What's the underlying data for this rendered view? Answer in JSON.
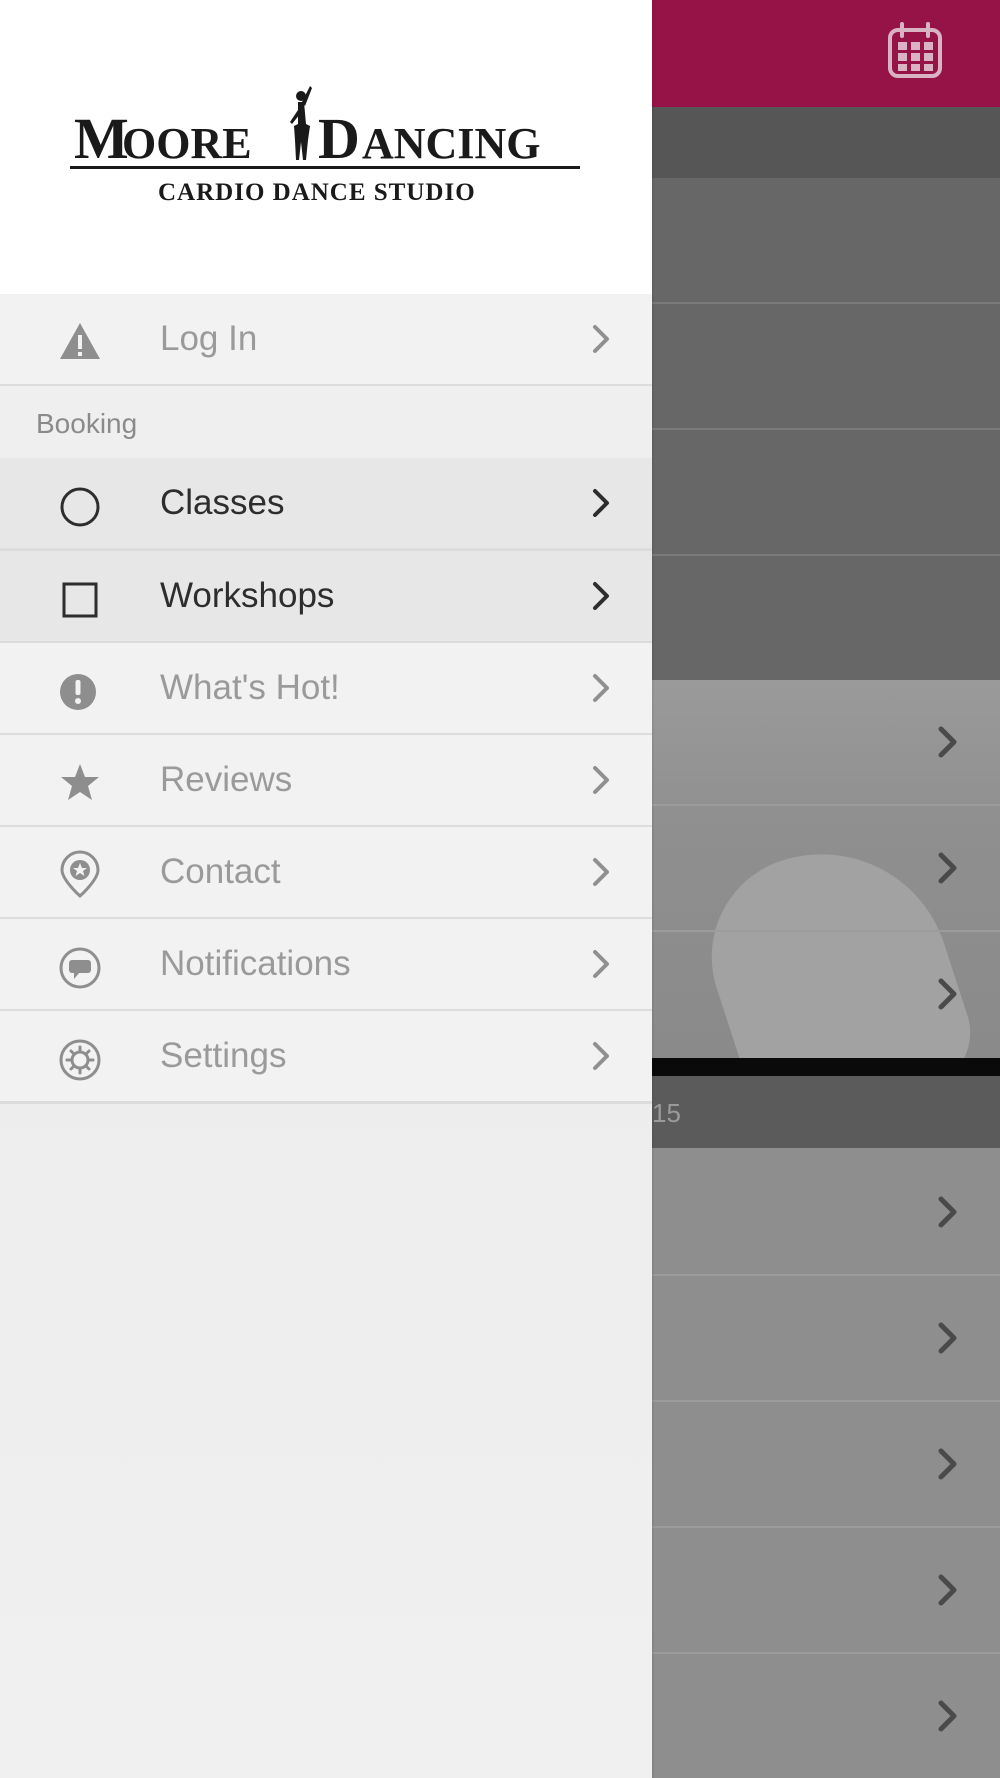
{
  "background_app": {
    "header_color": "#961348",
    "calendar_icon": "calendar-icon",
    "date_bar_text": "15",
    "chevron_icon": "chevron-right-icon"
  },
  "drawer": {
    "logo": {
      "name": "MOORE DANCING",
      "tagline": "CARDIO DANCE STUDIO"
    },
    "login": {
      "label": "Log In",
      "icon": "warning-icon"
    },
    "section_booking": "Booking",
    "items": [
      {
        "label": "Classes",
        "icon": "circle-icon"
      },
      {
        "label": "Workshops",
        "icon": "square-icon"
      },
      {
        "label": "What's Hot!",
        "icon": "exclamation-icon"
      },
      {
        "label": "Reviews",
        "icon": "star-icon"
      },
      {
        "label": "Contact",
        "icon": "map-pin-icon"
      },
      {
        "label": "Notifications",
        "icon": "chat-bubble-icon"
      },
      {
        "label": "Settings",
        "icon": "gear-icon"
      }
    ]
  }
}
